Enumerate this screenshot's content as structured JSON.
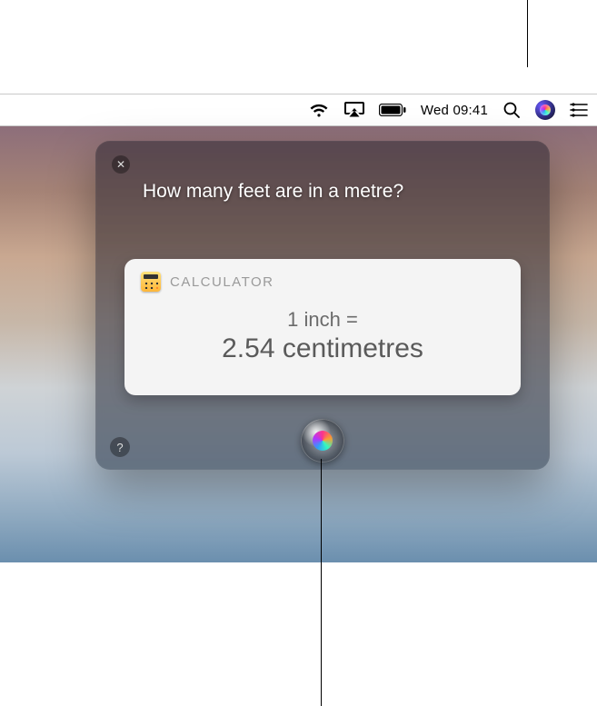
{
  "menubar": {
    "datetime": "Wed 09:41"
  },
  "siri": {
    "prompt": "How many feet are in a metre?",
    "card": {
      "app": "CALCULATOR",
      "line1": "1 inch =",
      "line2": "2.54 centimetres"
    },
    "help_glyph": "?",
    "close_glyph": "✕"
  }
}
